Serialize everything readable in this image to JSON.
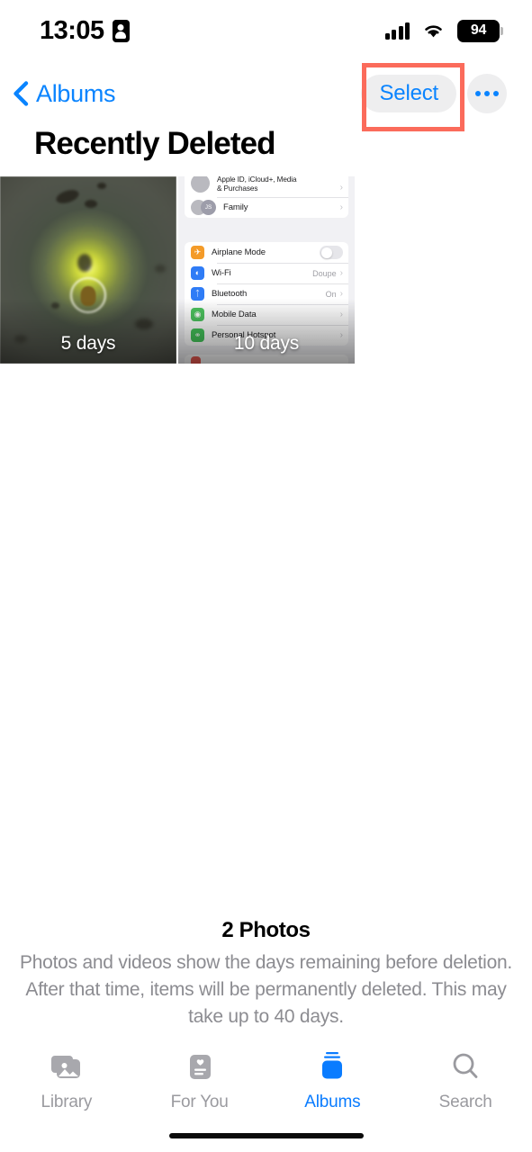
{
  "status_bar": {
    "time": "13:05",
    "id_card_icon": "contact-card-icon",
    "signal_icon": "cellular-signal-icon",
    "wifi_icon": "wifi-icon",
    "battery_percent": "94"
  },
  "nav": {
    "back_icon": "chevron-left-icon",
    "back_label": "Albums",
    "select_label": "Select",
    "more_icon": "ellipsis-icon",
    "highlight_color": "#fb6b5b",
    "accent_color": "#0a84ff"
  },
  "page": {
    "title": "Recently Deleted"
  },
  "grid": {
    "items": [
      {
        "name": "photo-thumbnail-1",
        "days_label": "5 days",
        "kind": "photo"
      },
      {
        "name": "photo-thumbnail-2",
        "days_label": "10 days",
        "kind": "screenshot"
      }
    ]
  },
  "screenshot_thumb": {
    "group1": [
      {
        "label": "Apple ID, iCloud+, Media & Purchases",
        "value": "",
        "icon": "avatar-photo",
        "chevron": "›"
      },
      {
        "label": "Family",
        "value": "",
        "icon": "avatar-pair",
        "avatar_initials": "JS",
        "chevron": "›"
      }
    ],
    "group2": [
      {
        "label": "Airplane Mode",
        "value": "",
        "icon": "airplane-icon",
        "icon_color": "#f49b29",
        "control": "toggle-off"
      },
      {
        "label": "Wi-Fi",
        "value": "Doupe",
        "icon": "wifi-icon",
        "icon_color": "#2f7cf6",
        "chevron": "›"
      },
      {
        "label": "Bluetooth",
        "value": "On",
        "icon": "bluetooth-icon",
        "icon_color": "#2f7cf6",
        "chevron": "›"
      },
      {
        "label": "Mobile Data",
        "value": "",
        "icon": "mobile-data-icon",
        "icon_color": "#4cc35e",
        "chevron": "›"
      },
      {
        "label": "Personal Hotspot",
        "value": "",
        "icon": "hotspot-icon",
        "icon_color": "#44c45a",
        "chevron": "›"
      }
    ]
  },
  "footer": {
    "count": "2 Photos",
    "description": "Photos and videos show the days remaining before deletion. After that time, items will be permanently deleted. This may take up to 40 days."
  },
  "tabbar": {
    "tabs": [
      {
        "label": "Library",
        "icon": "photo-stack-icon",
        "active": false
      },
      {
        "label": "For You",
        "icon": "for-you-card-icon",
        "active": false
      },
      {
        "label": "Albums",
        "icon": "albums-icon",
        "active": true
      },
      {
        "label": "Search",
        "icon": "magnifier-icon",
        "active": false
      }
    ],
    "active_color": "#0a7cff",
    "inactive_color": "#9a9a9f"
  }
}
